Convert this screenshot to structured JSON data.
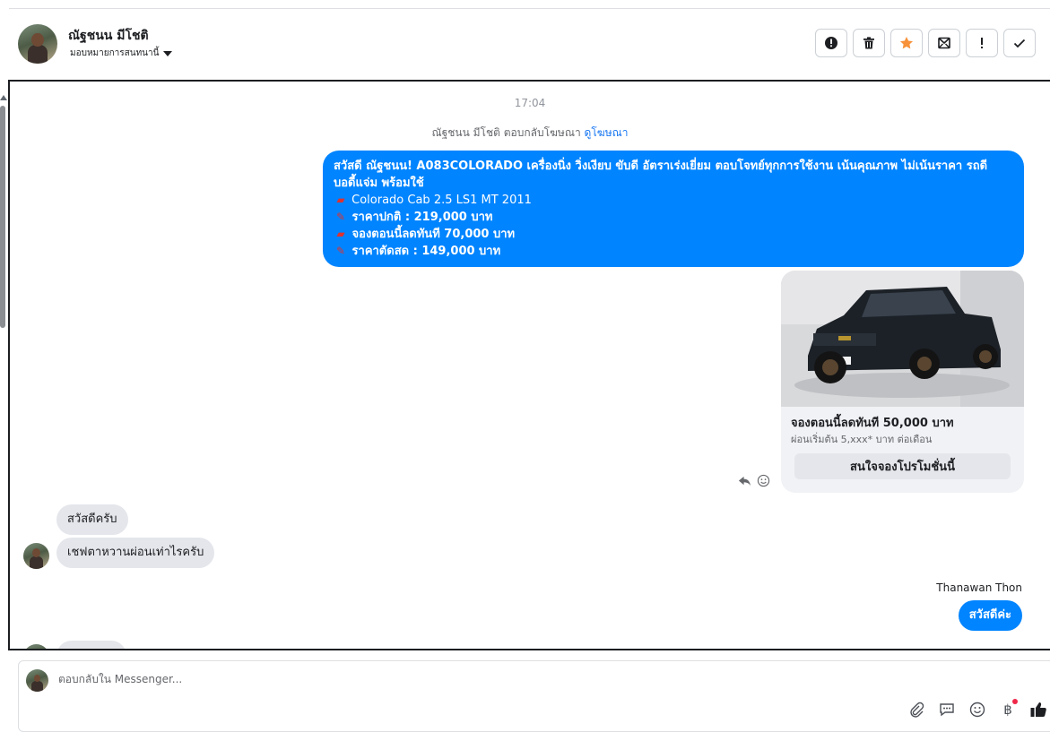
{
  "header": {
    "name": "ณัฐชนน มีโชติ",
    "assign_label": "มอบหมายการสนทนานี้"
  },
  "header_actions": [
    {
      "name": "spam-button",
      "icon": "alert-circle-icon"
    },
    {
      "name": "delete-button",
      "icon": "trash-icon"
    },
    {
      "name": "follow-up-button",
      "icon": "star-icon"
    },
    {
      "name": "mark-unread-button",
      "icon": "envelope-icon"
    },
    {
      "name": "priority-button",
      "icon": "exclamation-icon"
    },
    {
      "name": "mark-done-button",
      "icon": "check-icon"
    }
  ],
  "chat": {
    "timestamp": "17:04",
    "reply_note": "ณัฐชนน มีโชติ ตอบกลับโฆษณา",
    "reply_link": "ดูโฆษณา",
    "ad_message": {
      "line1": "สวัสดี ณัฐชนน! A083COLORADO เครื่องนิ่ง วิ่งเงียบ ขับดี อัตราเร่งเยี่ยม ตอบโจทย์ทุกการใช้งาน เน้นคุณภาพ ไม่เน้นราคา รถดี บอดี้แจ่ม พร้อมใช้",
      "line2": "Colorado Cab 2.5 LS1 MT 2011",
      "line3": "ราคาปกติ : 219,000 บาท",
      "line4": "จองตอนนี้ลดทันที 70,000 บาท",
      "line5": "ราคาตัดสด : 149,000 บาท",
      "emoji_car": "car-icon",
      "emoji_pin": "pushpin-icon"
    },
    "card": {
      "title": "จองตอนนี้ลดทันที 50,000 บาท",
      "subtitle": "ผ่อนเริ่มต้น 5,xxx* บาท ต่อเดือน",
      "button": "สนใจจองโปรโมชั่นนี้"
    },
    "incoming": [
      "สวัสดีครับ",
      "เชฟตาหวานผ่อนเท่าไรครับ"
    ],
    "sender_name": "Thanawan Thon",
    "outgoing_reply": "สวัสดีค่ะ"
  },
  "composer": {
    "placeholder": "ตอบกลับใน Messenger..."
  },
  "colors": {
    "accent": "#0084ff",
    "incoming_bubble": "#e4e6eb",
    "star": "#f7923a"
  }
}
